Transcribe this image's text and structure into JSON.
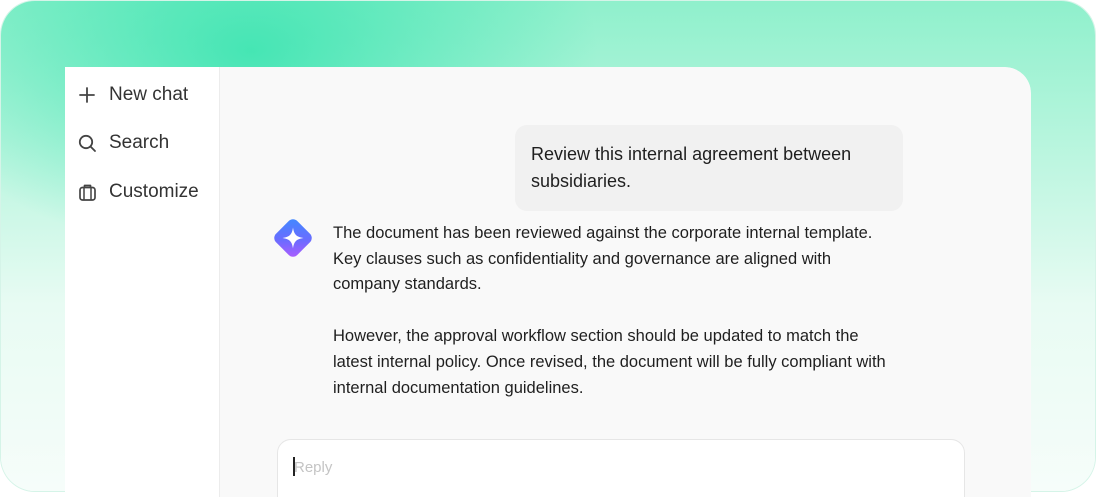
{
  "sidebar": {
    "items": [
      {
        "label": "New chat",
        "icon": "plus-icon"
      },
      {
        "label": "Search",
        "icon": "search-icon"
      },
      {
        "label": "Customize",
        "icon": "briefcase-icon"
      }
    ]
  },
  "conversation": {
    "user_message": "Review this internal agreement between subsidiaries.",
    "assistant_paragraphs": [
      "The document has been reviewed against the corporate internal template. Key clauses such as confidentiality and governance are aligned with company standards.",
      "However, the approval workflow section should be updated to match the latest internal policy. Once revised, the document will be fully compliant with internal documentation guidelines."
    ],
    "assistant_icon": "sparkle-icon"
  },
  "composer": {
    "placeholder": "Reply",
    "value": ""
  },
  "colors": {
    "accent_gradient_start": "#4f7dff",
    "accent_gradient_end": "#a35cff",
    "background_green": "#2ee3ae"
  }
}
